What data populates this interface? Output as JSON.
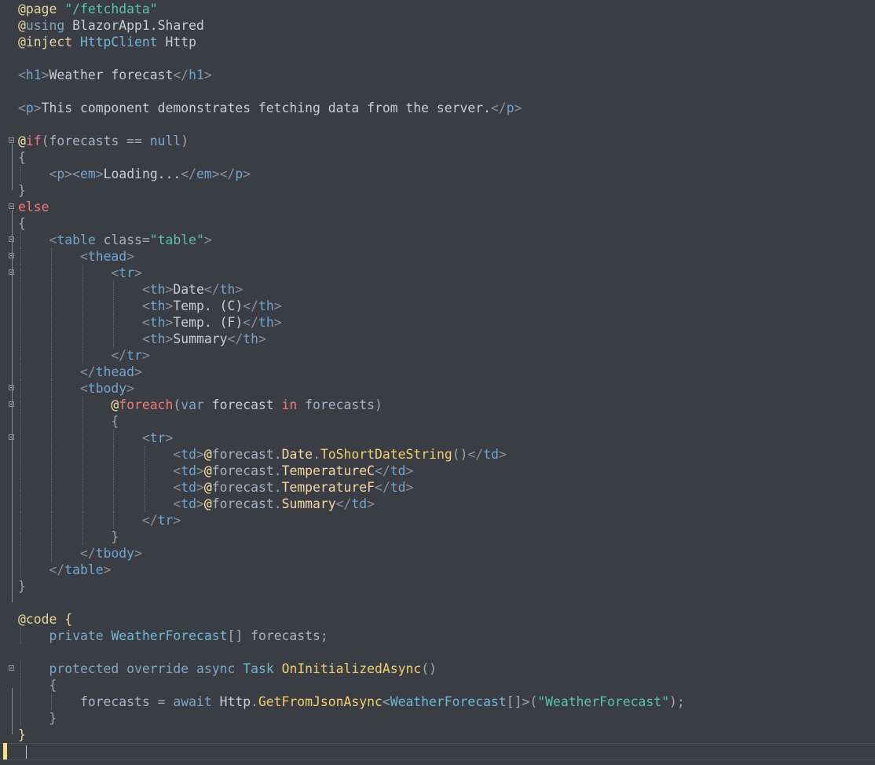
{
  "editor": {
    "language": "razor",
    "lines": [
      {
        "fold": false,
        "tokens": [
          {
            "t": "@page ",
            "c": "dir"
          },
          {
            "t": "\"/fetchdata\"",
            "c": "str"
          }
        ]
      },
      {
        "fold": false,
        "tokens": [
          {
            "t": "@",
            "c": "dir"
          },
          {
            "t": "using",
            "c": "kwb"
          },
          {
            "t": " BlazorApp1.Shared",
            "c": "txt"
          }
        ]
      },
      {
        "fold": false,
        "tokens": [
          {
            "t": "@inject ",
            "c": "dir"
          },
          {
            "t": "HttpClient",
            "c": "type"
          },
          {
            "t": " Http",
            "c": "txt"
          }
        ]
      },
      {
        "fold": false,
        "tokens": []
      },
      {
        "fold": false,
        "tokens": [
          {
            "t": "<",
            "c": "brk"
          },
          {
            "t": "h1",
            "c": "tag"
          },
          {
            "t": ">",
            "c": "brk"
          },
          {
            "t": "Weather forecast",
            "c": "txt"
          },
          {
            "t": "</",
            "c": "brk"
          },
          {
            "t": "h1",
            "c": "tag"
          },
          {
            "t": ">",
            "c": "brk"
          }
        ]
      },
      {
        "fold": false,
        "tokens": []
      },
      {
        "fold": false,
        "tokens": [
          {
            "t": "<",
            "c": "brk"
          },
          {
            "t": "p",
            "c": "tag"
          },
          {
            "t": ">",
            "c": "brk"
          },
          {
            "t": "This component demonstrates fetching data from the server.",
            "c": "txt"
          },
          {
            "t": "</",
            "c": "brk"
          },
          {
            "t": "p",
            "c": "tag"
          },
          {
            "t": ">",
            "c": "brk"
          }
        ]
      },
      {
        "fold": false,
        "tokens": []
      },
      {
        "fold": true,
        "tokens": [
          {
            "t": "@",
            "c": "at"
          },
          {
            "t": "if",
            "c": "kw"
          },
          {
            "t": "(",
            "c": "punc"
          },
          {
            "t": "forecasts",
            "c": "id"
          },
          {
            "t": " == ",
            "c": "punc"
          },
          {
            "t": "null",
            "c": "kwb"
          },
          {
            "t": ")",
            "c": "punc"
          }
        ]
      },
      {
        "fold": false,
        "tokens": [
          {
            "t": "{",
            "c": "punc"
          }
        ]
      },
      {
        "fold": false,
        "tokens": [
          {
            "t": "    ",
            "c": "txt"
          },
          {
            "t": "<",
            "c": "brk"
          },
          {
            "t": "p",
            "c": "tag"
          },
          {
            "t": "><",
            "c": "brk"
          },
          {
            "t": "em",
            "c": "tag"
          },
          {
            "t": ">",
            "c": "brk"
          },
          {
            "t": "Loading...",
            "c": "txt"
          },
          {
            "t": "</",
            "c": "brk"
          },
          {
            "t": "em",
            "c": "tag"
          },
          {
            "t": "></",
            "c": "brk"
          },
          {
            "t": "p",
            "c": "tag"
          },
          {
            "t": ">",
            "c": "brk"
          }
        ]
      },
      {
        "fold": false,
        "tokens": [
          {
            "t": "}",
            "c": "punc"
          }
        ]
      },
      {
        "fold": true,
        "tokens": [
          {
            "t": "else",
            "c": "kw"
          }
        ]
      },
      {
        "fold": false,
        "tokens": [
          {
            "t": "{",
            "c": "punc"
          }
        ]
      },
      {
        "fold": true,
        "tokens": [
          {
            "t": "    ",
            "c": "txt"
          },
          {
            "t": "<",
            "c": "brk"
          },
          {
            "t": "table",
            "c": "tag"
          },
          {
            "t": " class",
            "c": "id"
          },
          {
            "t": "=",
            "c": "punc"
          },
          {
            "t": "\"table\"",
            "c": "str"
          },
          {
            "t": ">",
            "c": "brk"
          }
        ]
      },
      {
        "fold": true,
        "tokens": [
          {
            "t": "        ",
            "c": "txt"
          },
          {
            "t": "<",
            "c": "brk"
          },
          {
            "t": "thead",
            "c": "tag"
          },
          {
            "t": ">",
            "c": "brk"
          }
        ]
      },
      {
        "fold": true,
        "tokens": [
          {
            "t": "            ",
            "c": "txt"
          },
          {
            "t": "<",
            "c": "brk"
          },
          {
            "t": "tr",
            "c": "tag"
          },
          {
            "t": ">",
            "c": "brk"
          }
        ]
      },
      {
        "fold": false,
        "tokens": [
          {
            "t": "                ",
            "c": "txt"
          },
          {
            "t": "<",
            "c": "brk"
          },
          {
            "t": "th",
            "c": "tag"
          },
          {
            "t": ">",
            "c": "brk"
          },
          {
            "t": "Date",
            "c": "txt"
          },
          {
            "t": "</",
            "c": "brk"
          },
          {
            "t": "th",
            "c": "tag"
          },
          {
            "t": ">",
            "c": "brk"
          }
        ]
      },
      {
        "fold": false,
        "tokens": [
          {
            "t": "                ",
            "c": "txt"
          },
          {
            "t": "<",
            "c": "brk"
          },
          {
            "t": "th",
            "c": "tag"
          },
          {
            "t": ">",
            "c": "brk"
          },
          {
            "t": "Temp. (C)",
            "c": "txt"
          },
          {
            "t": "</",
            "c": "brk"
          },
          {
            "t": "th",
            "c": "tag"
          },
          {
            "t": ">",
            "c": "brk"
          }
        ]
      },
      {
        "fold": false,
        "tokens": [
          {
            "t": "                ",
            "c": "txt"
          },
          {
            "t": "<",
            "c": "brk"
          },
          {
            "t": "th",
            "c": "tag"
          },
          {
            "t": ">",
            "c": "brk"
          },
          {
            "t": "Temp. (F)",
            "c": "txt"
          },
          {
            "t": "</",
            "c": "brk"
          },
          {
            "t": "th",
            "c": "tag"
          },
          {
            "t": ">",
            "c": "brk"
          }
        ]
      },
      {
        "fold": false,
        "tokens": [
          {
            "t": "                ",
            "c": "txt"
          },
          {
            "t": "<",
            "c": "brk"
          },
          {
            "t": "th",
            "c": "tag"
          },
          {
            "t": ">",
            "c": "brk"
          },
          {
            "t": "Summary",
            "c": "txt"
          },
          {
            "t": "</",
            "c": "brk"
          },
          {
            "t": "th",
            "c": "tag"
          },
          {
            "t": ">",
            "c": "brk"
          }
        ]
      },
      {
        "fold": false,
        "tokens": [
          {
            "t": "            ",
            "c": "txt"
          },
          {
            "t": "</",
            "c": "brk"
          },
          {
            "t": "tr",
            "c": "tag"
          },
          {
            "t": ">",
            "c": "brk"
          }
        ]
      },
      {
        "fold": false,
        "tokens": [
          {
            "t": "        ",
            "c": "txt"
          },
          {
            "t": "</",
            "c": "brk"
          },
          {
            "t": "thead",
            "c": "tag"
          },
          {
            "t": ">",
            "c": "brk"
          }
        ]
      },
      {
        "fold": true,
        "tokens": [
          {
            "t": "        ",
            "c": "txt"
          },
          {
            "t": "<",
            "c": "brk"
          },
          {
            "t": "tbody",
            "c": "tag"
          },
          {
            "t": ">",
            "c": "brk"
          }
        ]
      },
      {
        "fold": true,
        "tokens": [
          {
            "t": "            ",
            "c": "txt"
          },
          {
            "t": "@",
            "c": "at"
          },
          {
            "t": "foreach",
            "c": "kw"
          },
          {
            "t": "(",
            "c": "punc"
          },
          {
            "t": "var",
            "c": "kwb"
          },
          {
            "t": " forecast ",
            "c": "txt"
          },
          {
            "t": "in",
            "c": "kw"
          },
          {
            "t": " forecasts",
            "c": "id"
          },
          {
            "t": ")",
            "c": "punc"
          }
        ]
      },
      {
        "fold": false,
        "tokens": [
          {
            "t": "            ",
            "c": "txt"
          },
          {
            "t": "{",
            "c": "punc"
          }
        ]
      },
      {
        "fold": true,
        "tokens": [
          {
            "t": "                ",
            "c": "txt"
          },
          {
            "t": "<",
            "c": "brk"
          },
          {
            "t": "tr",
            "c": "tag"
          },
          {
            "t": ">",
            "c": "brk"
          }
        ]
      },
      {
        "fold": false,
        "tokens": [
          {
            "t": "                    ",
            "c": "txt"
          },
          {
            "t": "<",
            "c": "brk"
          },
          {
            "t": "td",
            "c": "tag"
          },
          {
            "t": ">",
            "c": "brk"
          },
          {
            "t": "@",
            "c": "at"
          },
          {
            "t": "forecast",
            "c": "id"
          },
          {
            "t": ".",
            "c": "punc"
          },
          {
            "t": "Date",
            "c": "mem"
          },
          {
            "t": ".",
            "c": "punc"
          },
          {
            "t": "ToShortDateString",
            "c": "meth"
          },
          {
            "t": "()",
            "c": "punc"
          },
          {
            "t": "</",
            "c": "brk"
          },
          {
            "t": "td",
            "c": "tag"
          },
          {
            "t": ">",
            "c": "brk"
          }
        ]
      },
      {
        "fold": false,
        "tokens": [
          {
            "t": "                    ",
            "c": "txt"
          },
          {
            "t": "<",
            "c": "brk"
          },
          {
            "t": "td",
            "c": "tag"
          },
          {
            "t": ">",
            "c": "brk"
          },
          {
            "t": "@",
            "c": "at"
          },
          {
            "t": "forecast",
            "c": "id"
          },
          {
            "t": ".",
            "c": "punc"
          },
          {
            "t": "TemperatureC",
            "c": "mem"
          },
          {
            "t": "</",
            "c": "brk"
          },
          {
            "t": "td",
            "c": "tag"
          },
          {
            "t": ">",
            "c": "brk"
          }
        ]
      },
      {
        "fold": false,
        "tokens": [
          {
            "t": "                    ",
            "c": "txt"
          },
          {
            "t": "<",
            "c": "brk"
          },
          {
            "t": "td",
            "c": "tag"
          },
          {
            "t": ">",
            "c": "brk"
          },
          {
            "t": "@",
            "c": "at"
          },
          {
            "t": "forecast",
            "c": "id"
          },
          {
            "t": ".",
            "c": "punc"
          },
          {
            "t": "TemperatureF",
            "c": "mem"
          },
          {
            "t": "</",
            "c": "brk"
          },
          {
            "t": "td",
            "c": "tag"
          },
          {
            "t": ">",
            "c": "brk"
          }
        ]
      },
      {
        "fold": false,
        "tokens": [
          {
            "t": "                    ",
            "c": "txt"
          },
          {
            "t": "<",
            "c": "brk"
          },
          {
            "t": "td",
            "c": "tag"
          },
          {
            "t": ">",
            "c": "brk"
          },
          {
            "t": "@",
            "c": "at"
          },
          {
            "t": "forecast",
            "c": "id"
          },
          {
            "t": ".",
            "c": "punc"
          },
          {
            "t": "Summary",
            "c": "mem"
          },
          {
            "t": "</",
            "c": "brk"
          },
          {
            "t": "td",
            "c": "tag"
          },
          {
            "t": ">",
            "c": "brk"
          }
        ]
      },
      {
        "fold": false,
        "tokens": [
          {
            "t": "                ",
            "c": "txt"
          },
          {
            "t": "</",
            "c": "brk"
          },
          {
            "t": "tr",
            "c": "tag"
          },
          {
            "t": ">",
            "c": "brk"
          }
        ]
      },
      {
        "fold": false,
        "tokens": [
          {
            "t": "            ",
            "c": "txt"
          },
          {
            "t": "}",
            "c": "punc"
          }
        ]
      },
      {
        "fold": false,
        "tokens": [
          {
            "t": "        ",
            "c": "txt"
          },
          {
            "t": "</",
            "c": "brk"
          },
          {
            "t": "tbody",
            "c": "tag"
          },
          {
            "t": ">",
            "c": "brk"
          }
        ]
      },
      {
        "fold": false,
        "tokens": [
          {
            "t": "    ",
            "c": "txt"
          },
          {
            "t": "</",
            "c": "brk"
          },
          {
            "t": "table",
            "c": "tag"
          },
          {
            "t": ">",
            "c": "brk"
          }
        ]
      },
      {
        "fold": false,
        "tokens": [
          {
            "t": "}",
            "c": "punc"
          }
        ]
      },
      {
        "fold": false,
        "tokens": []
      },
      {
        "fold": false,
        "tokens": [
          {
            "t": "@code ",
            "c": "dir"
          },
          {
            "t": "{",
            "c": "dir"
          }
        ]
      },
      {
        "fold": false,
        "tokens": [
          {
            "t": "    ",
            "c": "txt"
          },
          {
            "t": "private",
            "c": "kwb"
          },
          {
            "t": " ",
            "c": "txt"
          },
          {
            "t": "WeatherForecast",
            "c": "type"
          },
          {
            "t": "[]",
            "c": "punc"
          },
          {
            "t": " forecasts;",
            "c": "id"
          }
        ]
      },
      {
        "fold": false,
        "tokens": []
      },
      {
        "fold": true,
        "tokens": [
          {
            "t": "    ",
            "c": "txt"
          },
          {
            "t": "protected",
            "c": "kwb"
          },
          {
            "t": " ",
            "c": "txt"
          },
          {
            "t": "override",
            "c": "kwb"
          },
          {
            "t": " ",
            "c": "txt"
          },
          {
            "t": "async",
            "c": "kwb"
          },
          {
            "t": " ",
            "c": "txt"
          },
          {
            "t": "Task",
            "c": "type"
          },
          {
            "t": " ",
            "c": "txt"
          },
          {
            "t": "OnInitializedAsync",
            "c": "meth"
          },
          {
            "t": "()",
            "c": "punc"
          }
        ]
      },
      {
        "fold": false,
        "tokens": [
          {
            "t": "    ",
            "c": "txt"
          },
          {
            "t": "{",
            "c": "punc"
          }
        ]
      },
      {
        "fold": false,
        "tokens": [
          {
            "t": "        ",
            "c": "txt"
          },
          {
            "t": "forecasts",
            "c": "id"
          },
          {
            "t": " = ",
            "c": "punc"
          },
          {
            "t": "await",
            "c": "kwb"
          },
          {
            "t": " Http",
            "c": "txt"
          },
          {
            "t": ".",
            "c": "punc"
          },
          {
            "t": "GetFromJsonAsync",
            "c": "meth"
          },
          {
            "t": "<",
            "c": "punc"
          },
          {
            "t": "WeatherForecast",
            "c": "type"
          },
          {
            "t": "[]>(",
            "c": "punc"
          },
          {
            "t": "\"WeatherForecast\"",
            "c": "str"
          },
          {
            "t": ");",
            "c": "punc"
          }
        ]
      },
      {
        "fold": false,
        "tokens": [
          {
            "t": "    ",
            "c": "txt"
          },
          {
            "t": "}",
            "c": "punc"
          }
        ]
      },
      {
        "fold": false,
        "tokens": [
          {
            "t": "}",
            "c": "dir"
          }
        ]
      }
    ],
    "colors": {
      "background": "#3a3d44",
      "directive": "#e8d79b",
      "keyword": "#f07a7a",
      "string": "#58c4a6",
      "tag": "#6ea6d0",
      "method": "#f1cf70",
      "modified_marker": "#f2e08a"
    }
  }
}
